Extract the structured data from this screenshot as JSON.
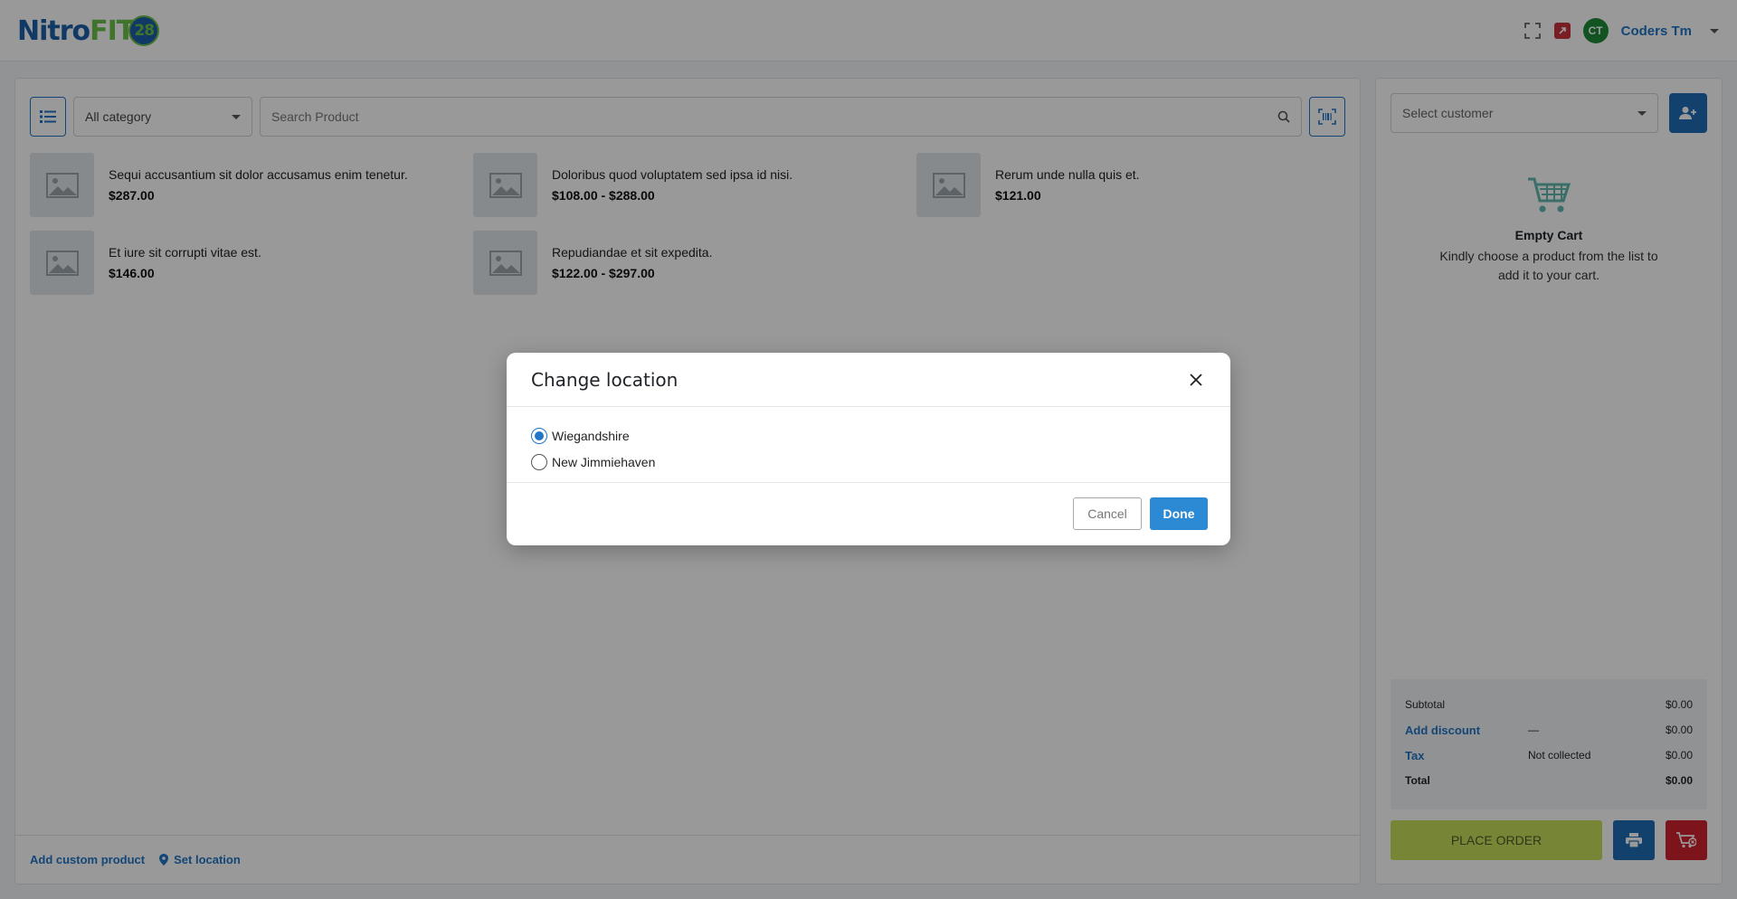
{
  "brand": {
    "part1": "Nitro",
    "part2": "FIT",
    "part3": "28"
  },
  "header": {
    "avatar_initials": "CT",
    "user_name": "Coders Tm"
  },
  "toolbar": {
    "category_value": "All category",
    "search_placeholder": "Search Product"
  },
  "products": [
    {
      "name": "Sequi accusantium sit dolor accusamus enim tenetur.",
      "price": "$287.00"
    },
    {
      "name": "Doloribus quod voluptatem sed ipsa id nisi.",
      "price": "$108.00 - $288.00"
    },
    {
      "name": "Rerum unde nulla quis et.",
      "price": "$121.00"
    },
    {
      "name": "Et iure sit corrupti vitae est.",
      "price": "$146.00"
    },
    {
      "name": "Repudiandae et sit expedita.",
      "price": "$122.00 - $297.00"
    }
  ],
  "footer": {
    "add_custom": "Add custom product",
    "set_location": "Set location"
  },
  "cart": {
    "customer_placeholder": "Select customer",
    "empty_title": "Empty Cart",
    "empty_desc_line1": "Kindly choose a product from the list to",
    "empty_desc_line2": "add it to your cart.",
    "subtotal_label": "Subtotal",
    "subtotal_value": "$0.00",
    "discount_label": "Add discount",
    "discount_mid": "—",
    "discount_value": "$0.00",
    "tax_label": "Tax",
    "tax_mid": "Not collected",
    "tax_value": "$0.00",
    "total_label": "Total",
    "total_value": "$0.00",
    "place_order": "PLACE ORDER"
  },
  "modal": {
    "title": "Change location",
    "options": [
      {
        "label": "Wiegandshire",
        "selected": true
      },
      {
        "label": "New Jimmiehaven",
        "selected": false
      }
    ],
    "cancel": "Cancel",
    "done": "Done"
  },
  "colors": {
    "primary": "#2176c7",
    "danger": "#d2222d",
    "place_order": "#c5e05a"
  }
}
